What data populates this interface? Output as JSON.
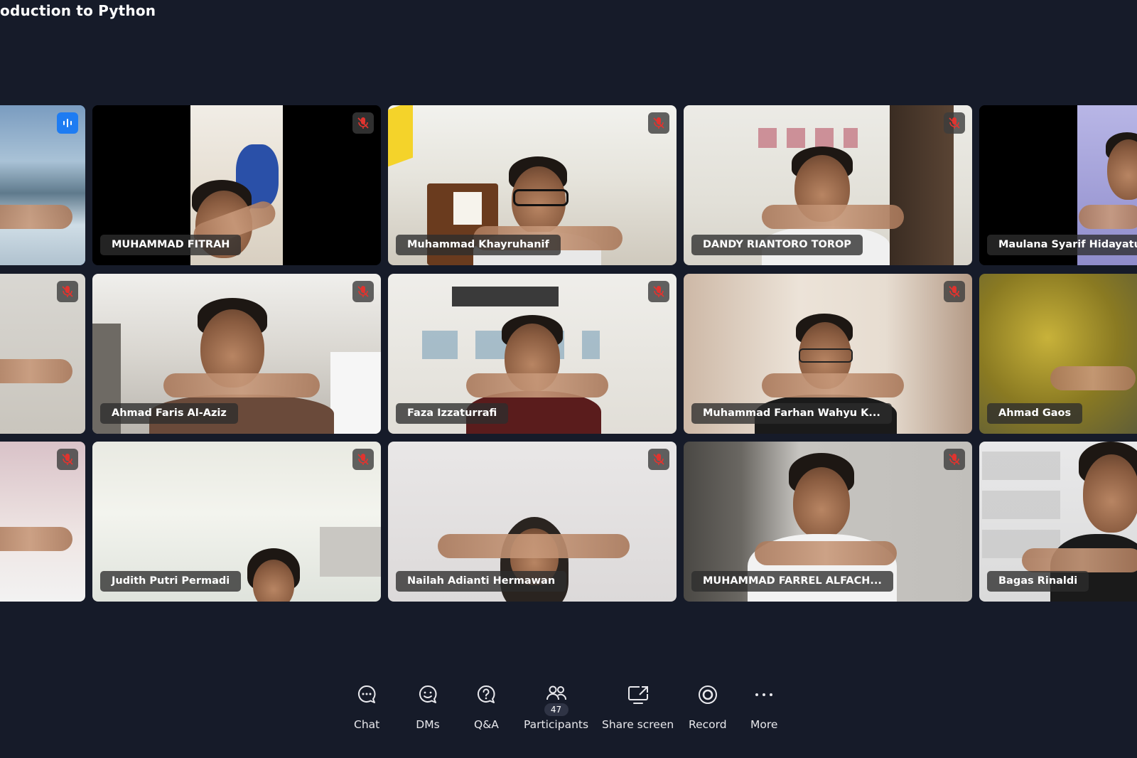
{
  "meeting": {
    "title": "oduction to Python"
  },
  "colors": {
    "background": "#161b29",
    "accent": "#1e7cf2",
    "mute": "#e0342f"
  },
  "participants": [
    {
      "name": "",
      "status": "speaking"
    },
    {
      "name": "MUHAMMAD FITRAH",
      "status": "muted"
    },
    {
      "name": "Muhammad Khayruhanif",
      "status": "muted"
    },
    {
      "name": "DANDY RIANTORO TOROP",
      "status": "muted"
    },
    {
      "name": "Maulana Syarif Hidayatullah",
      "status": "muted"
    },
    {
      "name": "",
      "status": "muted"
    },
    {
      "name": "Ahmad Faris Al-Aziz",
      "status": "muted"
    },
    {
      "name": "Faza Izzaturrafi",
      "status": "muted"
    },
    {
      "name": "Muhammad Farhan Wahyu K...",
      "status": "muted"
    },
    {
      "name": "Ahmad Gaos",
      "status": "muted"
    },
    {
      "name": "",
      "status": "muted"
    },
    {
      "name": "Judith Putri Permadi",
      "status": "muted"
    },
    {
      "name": "Nailah Adianti Hermawan",
      "status": "muted"
    },
    {
      "name": "MUHAMMAD FARREL ALFACH...",
      "status": "muted"
    },
    {
      "name": "Bagas Rinaldi",
      "status": "muted"
    }
  ],
  "toolbar": {
    "chat": {
      "label": "Chat",
      "icon": "chat-icon"
    },
    "dms": {
      "label": "DMs",
      "icon": "dm-icon"
    },
    "qa": {
      "label": "Q&A",
      "icon": "qa-icon"
    },
    "participants": {
      "label": "Participants",
      "icon": "participants-icon",
      "count": "47"
    },
    "share": {
      "label": "Share screen",
      "icon": "share-screen-icon"
    },
    "record": {
      "label": "Record",
      "icon": "record-icon"
    },
    "more": {
      "label": "More",
      "icon": "more-icon"
    }
  }
}
